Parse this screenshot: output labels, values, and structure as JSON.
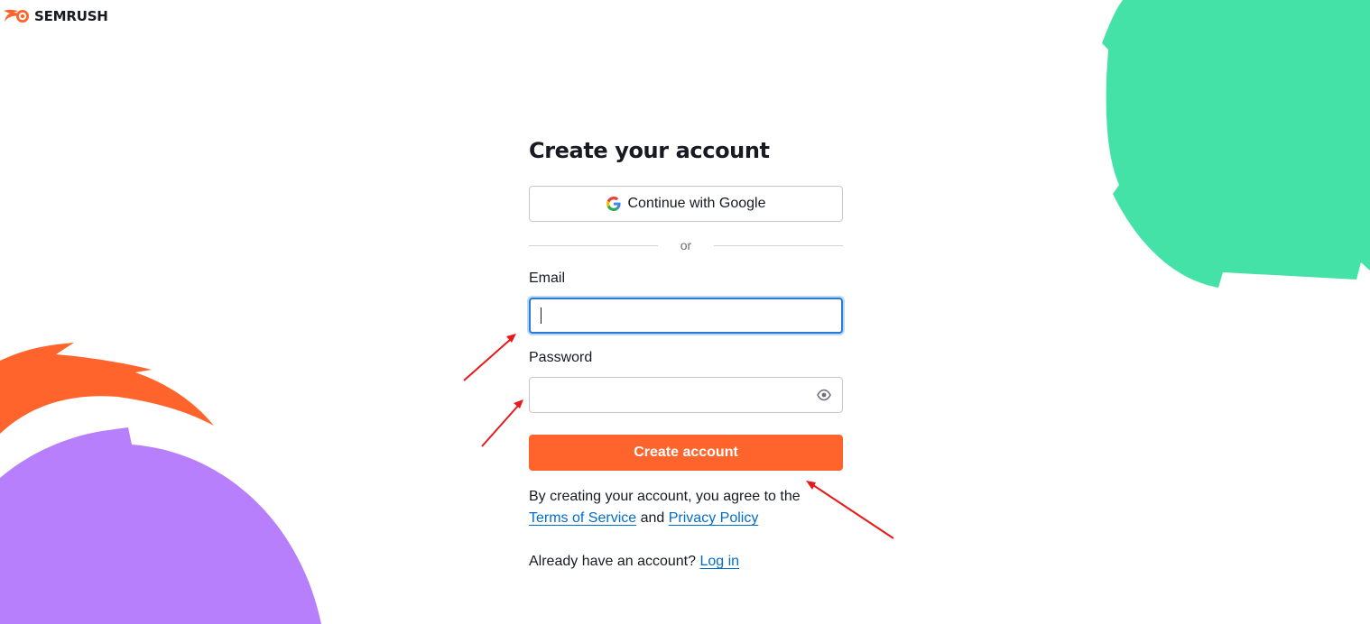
{
  "brand": {
    "name": "SEMRUSH",
    "colors": {
      "orange": "#ff642d",
      "green": "#45e2a8",
      "purple": "#b77ffc",
      "link": "#006dca"
    }
  },
  "signup": {
    "title": "Create your account",
    "google_button": {
      "label": "Continue with Google",
      "icon": "google-icon"
    },
    "divider_text": "or",
    "email": {
      "label": "Email",
      "value": "",
      "placeholder": ""
    },
    "password": {
      "label": "Password",
      "value": "",
      "placeholder": "",
      "icon": "eye-icon"
    },
    "submit_label": "Create account",
    "terms": {
      "prefix": "By creating your account, you agree to the",
      "tos_link": "Terms of Service",
      "conjunction": "and",
      "privacy_link": "Privacy Policy"
    },
    "login": {
      "prompt": "Already have an account?",
      "link": "Log in"
    }
  },
  "annotations": {
    "arrow_color": "#e8191a",
    "arrow_count": 3
  }
}
